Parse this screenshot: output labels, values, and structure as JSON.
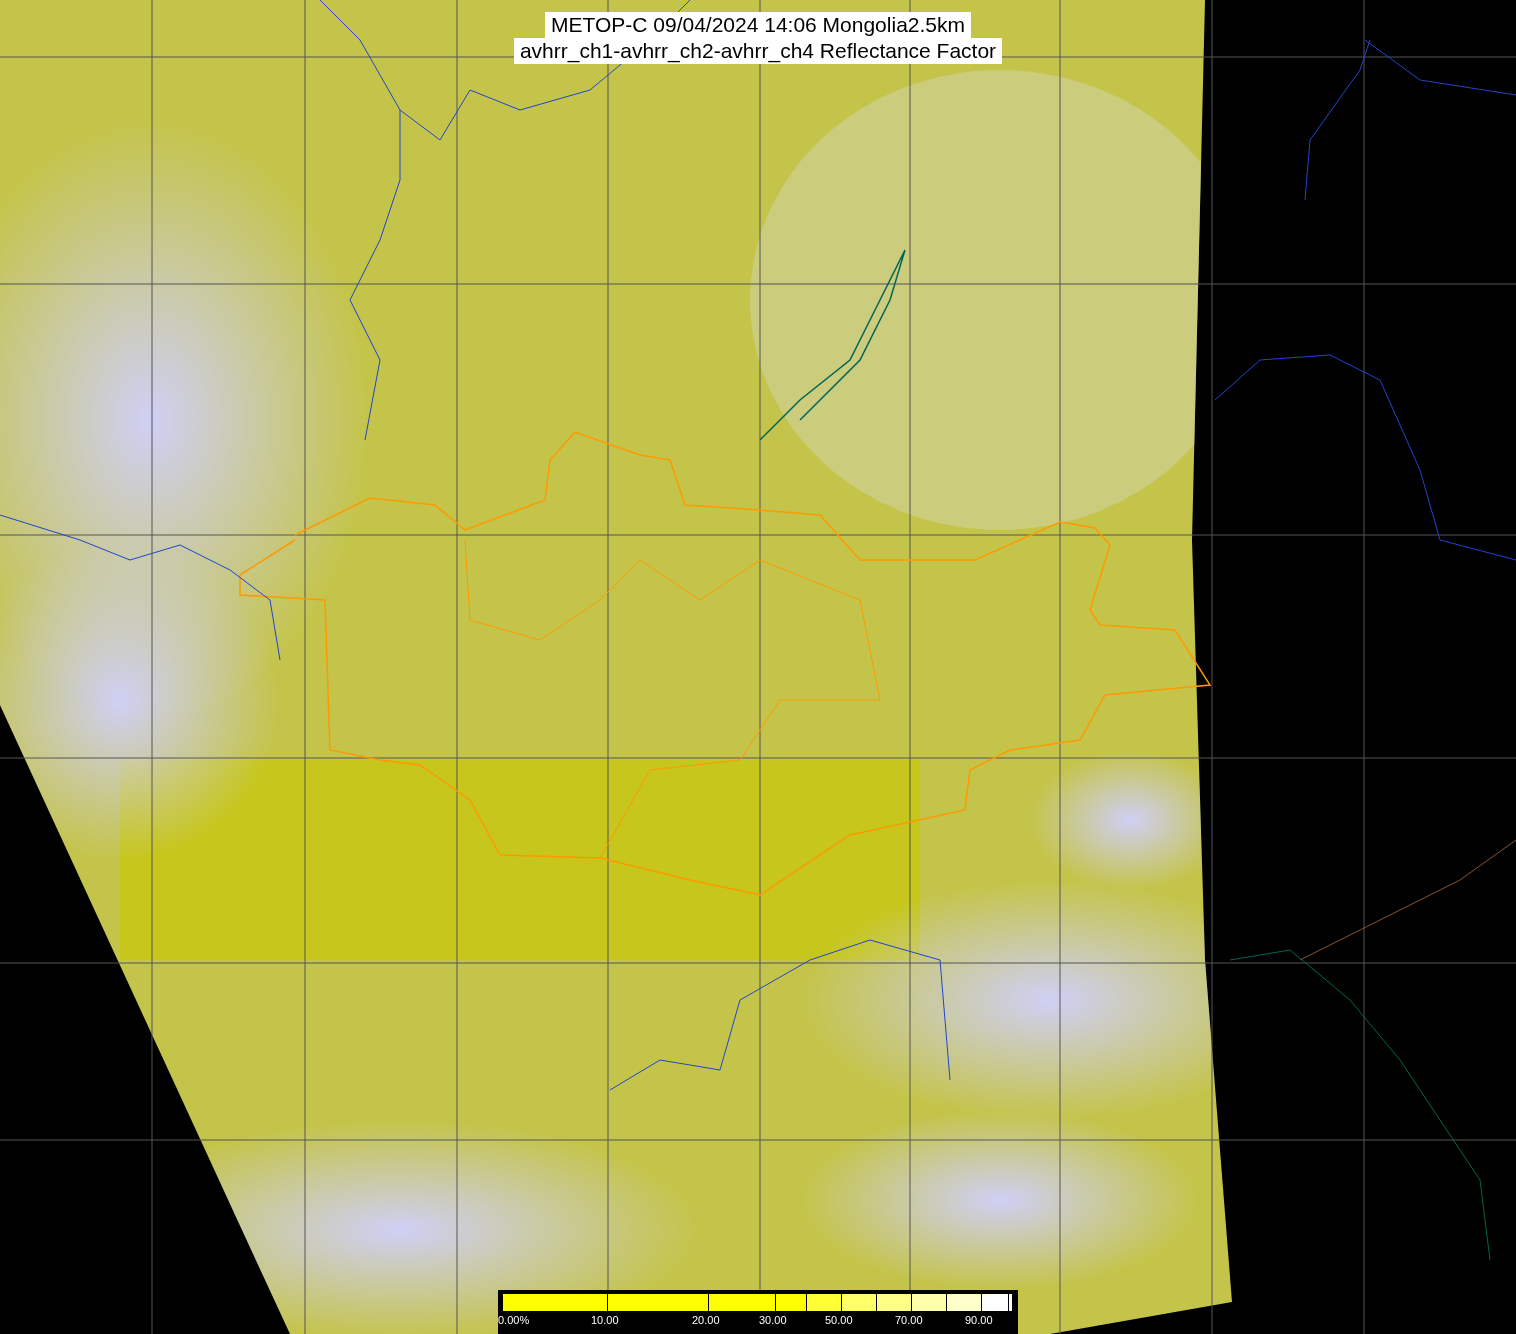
{
  "title": {
    "lines": [
      "METOP-C 09/04/2024 14:06 Mongolia2.5km",
      "avhrr_ch1-avhrr_ch2-avhrr_ch4 Reflectance Factor"
    ]
  },
  "colorbar": {
    "segments": [
      {
        "color": "#ffff00",
        "tick": "0.00%"
      },
      {
        "color": "#ffff00",
        "tick": "10.00"
      },
      {
        "color": "#ffff00",
        "tick": "20.00"
      },
      {
        "color": "#ffff00",
        "tick": "30.00"
      },
      {
        "color": "#ffff33"
      },
      {
        "color": "#ffff66",
        "tick": "50.00"
      },
      {
        "color": "#ffff88"
      },
      {
        "color": "#ffffaa",
        "tick": "70.00"
      },
      {
        "color": "#ffffcc"
      },
      {
        "color": "#ffffff",
        "tick": "90.00"
      },
      {
        "color": "#ffffff"
      }
    ]
  }
}
